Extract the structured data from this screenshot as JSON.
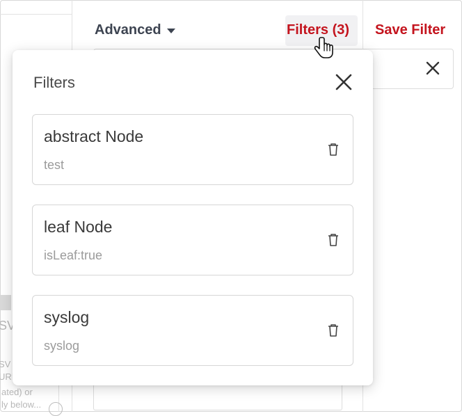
{
  "toolbar": {
    "advanced_label": "Advanced",
    "filters_label": "Filters (3)",
    "save_filter_label": "Save Filter"
  },
  "colors": {
    "accent_red": "#c4141e",
    "text_dark": "#3d4451",
    "muted": "#9b9b9b"
  },
  "left_partial": {
    "line1": "SV",
    "line2": "SV",
    "line3": "URI",
    "line4": "ated) or",
    "line5": "ly below..."
  },
  "popover": {
    "title": "Filters",
    "close_icon": "close-icon",
    "filters": [
      {
        "name": "abstract Node",
        "query": "test",
        "delete_icon": "trash-icon"
      },
      {
        "name": "leaf Node",
        "query": "isLeaf:true",
        "delete_icon": "trash-icon"
      },
      {
        "name": "syslog",
        "query": "syslog",
        "delete_icon": "trash-icon"
      }
    ]
  }
}
